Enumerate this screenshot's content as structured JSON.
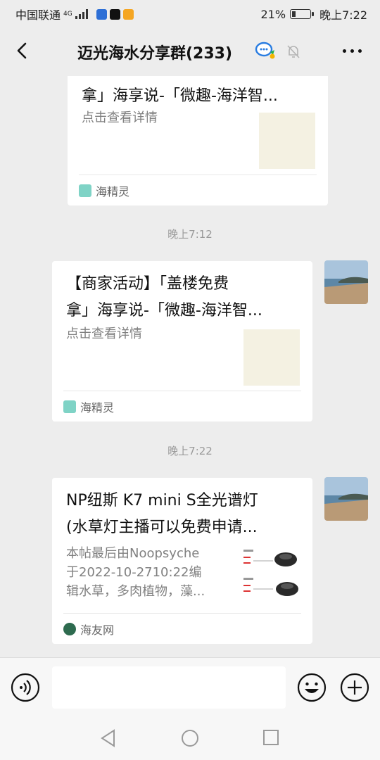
{
  "status_bar": {
    "carrier": "中国联通",
    "network": "4G",
    "battery_percent": "21%",
    "battery_level": 0.21,
    "time": "晚上7:22"
  },
  "header": {
    "title": "迈光海水分享群(233)",
    "icons": [
      "back-chevron-icon",
      "chat-bubbles-icon",
      "bell-muted-icon",
      "more-dots-icon"
    ]
  },
  "messages": [
    {
      "title_lines": [
        "拿」海享说-「微趣-海洋智..."
      ],
      "desc": "点击查看详情",
      "source": "海精灵"
    },
    {
      "time": "晚上7:12",
      "title_lines": [
        "【商家活动】「盖楼免费",
        "拿」海享说-「微趣-海洋智..."
      ],
      "desc": "点击查看详情",
      "source": "海精灵"
    },
    {
      "time": "晚上7:22",
      "title_lines": [
        "NP纽斯 K7 mini S全光谱灯",
        "(水草灯主播可以免费申请..."
      ],
      "desc_lines": [
        "本帖最后由Noopsyche",
        "于2022-10-2710:22编",
        "辑水草，多肉植物，藻..."
      ],
      "source": "海友网"
    }
  ],
  "input_bar": {
    "icons": [
      "voice-icon",
      "emoji-icon",
      "plus-icon"
    ]
  },
  "system_nav": {
    "icons": [
      "nav-back-icon",
      "nav-home-icon",
      "nav-recent-icon"
    ]
  },
  "colors": {
    "background": "#ededed",
    "card": "#ffffff",
    "muted_text": "#808080",
    "time_text": "#9a9a9a"
  }
}
